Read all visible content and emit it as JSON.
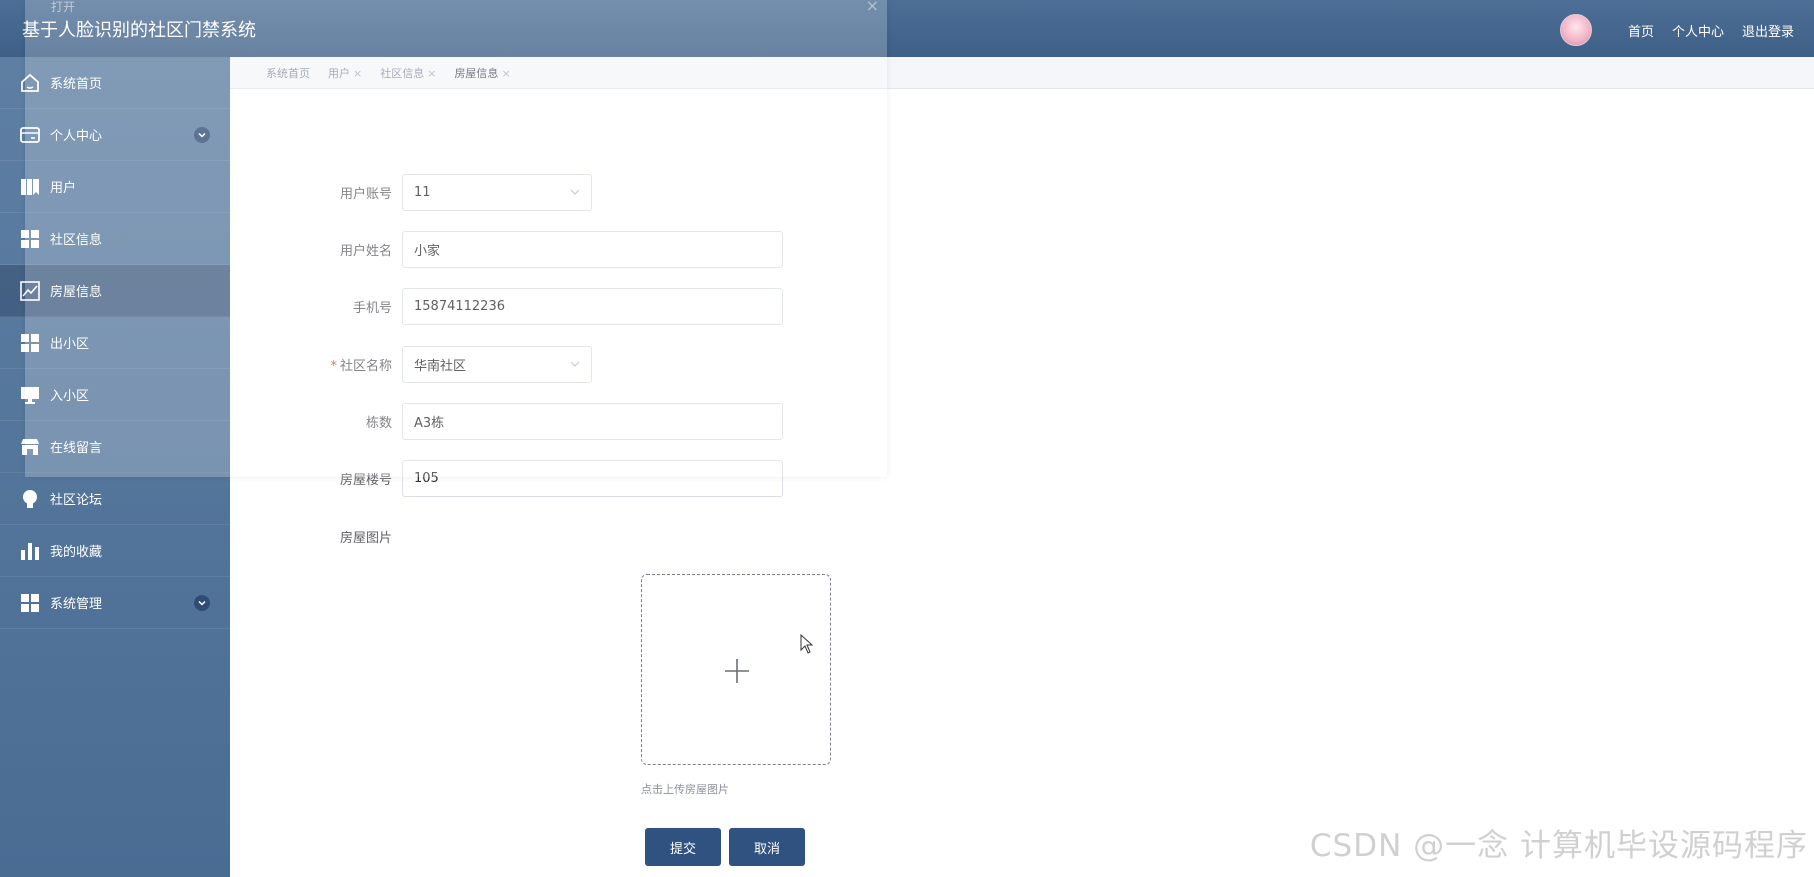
{
  "header": {
    "title": "基于人脸识别的社区门禁系统",
    "nav": [
      "首页",
      "个人中心",
      "退出登录"
    ]
  },
  "sidebar": {
    "items": [
      {
        "label": "系统首页",
        "icon": "home-icon"
      },
      {
        "label": "个人中心",
        "icon": "card-icon",
        "expandable": true
      },
      {
        "label": "用户",
        "icon": "book-icon"
      },
      {
        "label": "社区信息",
        "icon": "grid-icon"
      },
      {
        "label": "房屋信息",
        "icon": "chart-line-icon",
        "active": true
      },
      {
        "label": "出小区",
        "icon": "grid-icon"
      },
      {
        "label": "入小区",
        "icon": "monitor-icon"
      },
      {
        "label": "在线留言",
        "icon": "shop-icon"
      },
      {
        "label": "社区论坛",
        "icon": "bulb-icon"
      },
      {
        "label": "我的收藏",
        "icon": "bar-chart-icon"
      },
      {
        "label": "系统管理",
        "icon": "grid-icon",
        "expandable": true
      }
    ]
  },
  "breadcrumb": [
    "系统首页",
    "用户",
    "社区信息",
    "房屋信息"
  ],
  "dialog": {
    "title": "打开"
  },
  "form": {
    "account": {
      "label": "用户账号",
      "value": "11"
    },
    "name": {
      "label": "用户姓名",
      "value": "小家"
    },
    "phone": {
      "label": "手机号",
      "value": "15874112236"
    },
    "community": {
      "label": "社区名称",
      "value": "华南社区",
      "required": true
    },
    "building": {
      "label": "栋数",
      "value": "A3栋"
    },
    "room": {
      "label": "房屋楼号",
      "value": "105"
    },
    "photo": {
      "label": "房屋图片",
      "hint": "点击上传房屋图片"
    },
    "submit_label": "提交",
    "cancel_label": "取消"
  },
  "watermark": "CSDN @一念 计算机毕设源码程序",
  "colors": {
    "header": "#3e5f86",
    "sidebar": "#5e7fa3",
    "button": "#2f5280",
    "required": "#e04646"
  }
}
